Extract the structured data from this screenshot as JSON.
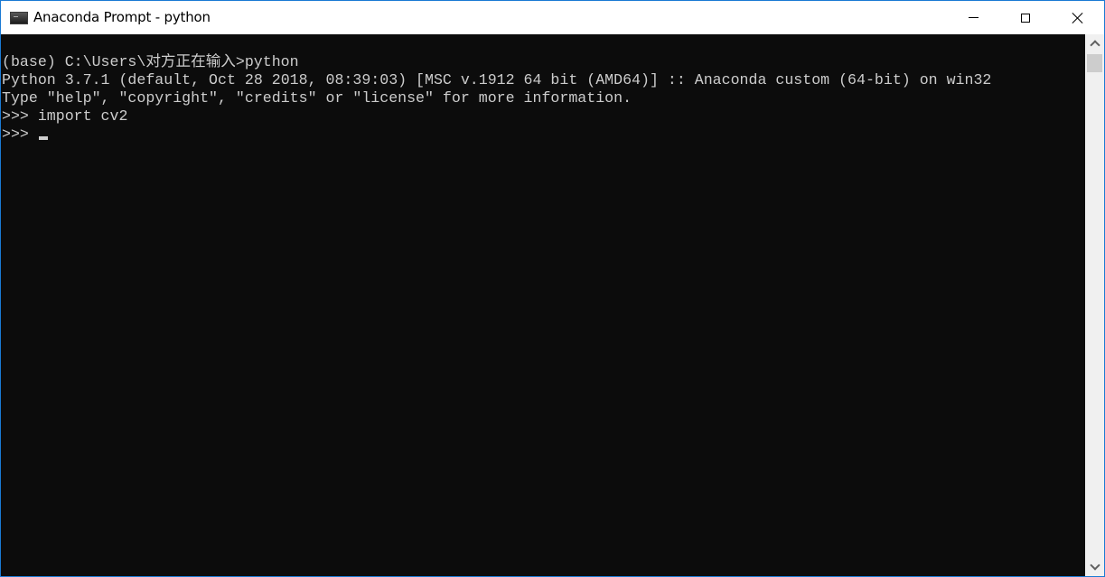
{
  "window": {
    "title": "Anaconda Prompt - python",
    "app_icon": "terminal-icon",
    "controls": {
      "minimize": "minimize-icon",
      "maximize": "maximize-icon",
      "close": "close-icon"
    }
  },
  "console": {
    "lines": [
      "(base) C:\\Users\\对方正在输入>python",
      "Python 3.7.1 (default, Oct 28 2018, 08:39:03) [MSC v.1912 64 bit (AMD64)] :: Anaconda custom (64-bit) on win32",
      "Type \"help\", \"copyright\", \"credits\" or \"license\" for more information.",
      ">>> import cv2",
      ">>> "
    ],
    "colors": {
      "background": "#0c0c0c",
      "foreground": "#cccccc"
    }
  },
  "scrollbar": {
    "up_icon": "chevron-up-icon",
    "down_icon": "chevron-down-icon"
  }
}
